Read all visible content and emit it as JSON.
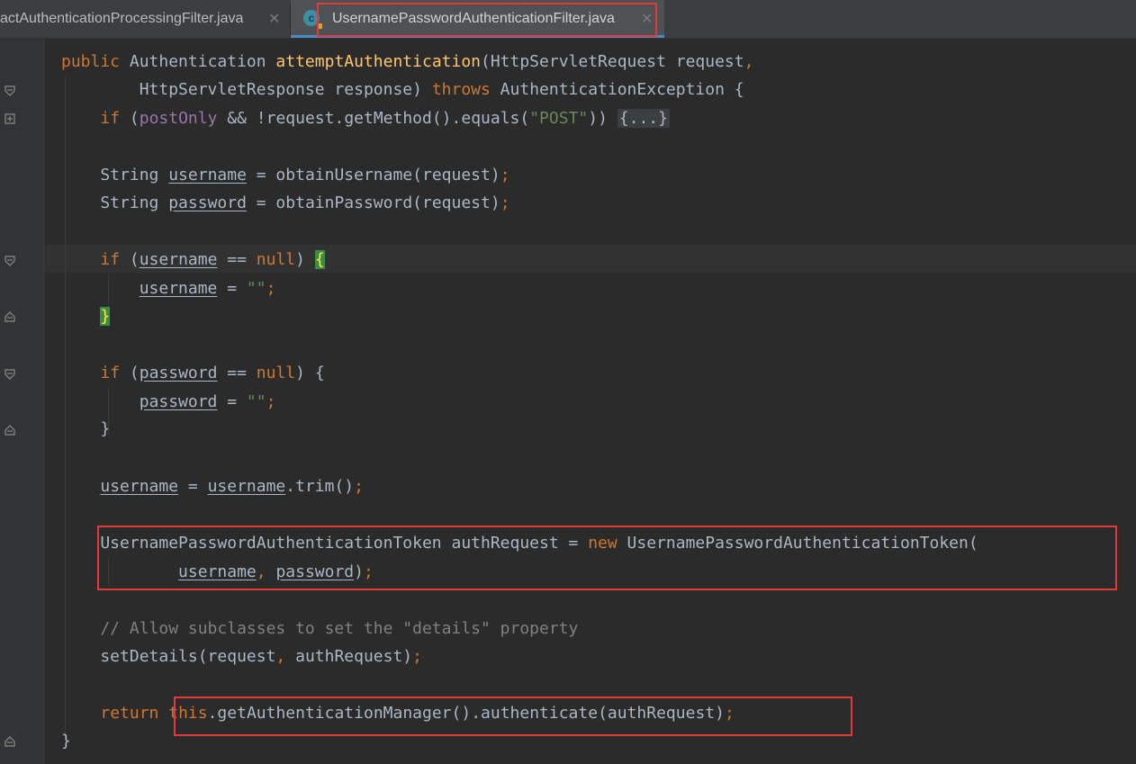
{
  "tabs": [
    {
      "label": "actAuthenticationProcessingFilter.java",
      "active": false
    },
    {
      "label": "UsernamePasswordAuthenticationFilter.java",
      "active": true,
      "icon": "class-icon",
      "icon_letter": "c"
    }
  ],
  "code": {
    "l1": {
      "t1": "public",
      "t2": " Authentication ",
      "t3": "attemptAuthentication",
      "t4": "(HttpServletRequest request",
      "t5": ","
    },
    "l2": {
      "t1": "        HttpServletResponse response) ",
      "t2": "throws",
      "t3": " AuthenticationException {"
    },
    "l3": {
      "t1": "    ",
      "t2": "if",
      "t3": " (",
      "t4": "postOnly",
      "t5": " && !request.getMethod().equals(",
      "t6": "\"POST\"",
      "t7": ")) ",
      "t8": "{...}"
    },
    "l5": {
      "t1": "    String ",
      "t2": "username",
      "t3": " = obtainUsername(request)",
      "t4": ";"
    },
    "l6": {
      "t1": "    String ",
      "t2": "password",
      "t3": " = obtainPassword(request)",
      "t4": ";"
    },
    "l8": {
      "t1": "    ",
      "t2": "if",
      "t3": " (",
      "t4": "username",
      "t5": " == ",
      "t6": "null",
      "t7": ") ",
      "t8": "{"
    },
    "l9": {
      "t1": "        ",
      "t2": "username",
      "t3": " = ",
      "t4": "\"\"",
      "t5": ";"
    },
    "l10": {
      "t1": "    ",
      "t2": "}"
    },
    "l12": {
      "t1": "    ",
      "t2": "if",
      "t3": " (",
      "t4": "password",
      "t5": " == ",
      "t6": "null",
      "t7": ") {"
    },
    "l13": {
      "t1": "        ",
      "t2": "password",
      "t3": " = ",
      "t4": "\"\"",
      "t5": ";"
    },
    "l14": {
      "t1": "    }"
    },
    "l16": {
      "t1": "    ",
      "t2": "username",
      "t3": " = ",
      "t4": "username",
      "t5": ".trim()",
      "t6": ";"
    },
    "l18": {
      "t1": "    UsernamePasswordAuthenticationToken authRequest = ",
      "t2": "new",
      "t3": " UsernamePasswordAuthenticationToken("
    },
    "l19": {
      "t1": "            ",
      "t2": "username",
      "t3": ", ",
      "t4": "password",
      "t5": ")",
      "t6": ";"
    },
    "l21": {
      "t1": "    // Allow subclasses to set the \"details\" property"
    },
    "l22": {
      "t1": "    setDetails(request",
      "t2": ",",
      "t3": " authRequest)",
      "t4": ";"
    },
    "l24": {
      "t1": "    ",
      "t2": "return",
      "t3": " ",
      "t4": "this",
      "t5": ".getAuthenticationManager().authenticate(authRequest)",
      "t6": ";"
    },
    "l25": {
      "t1": "}"
    }
  },
  "colors": {
    "keyword": "#cc7832",
    "method_decl": "#ffc66d",
    "field": "#9876aa",
    "string": "#6a8759",
    "comment": "#808080",
    "text": "#a9b7c6",
    "highlight_box": "#e03a3a"
  }
}
